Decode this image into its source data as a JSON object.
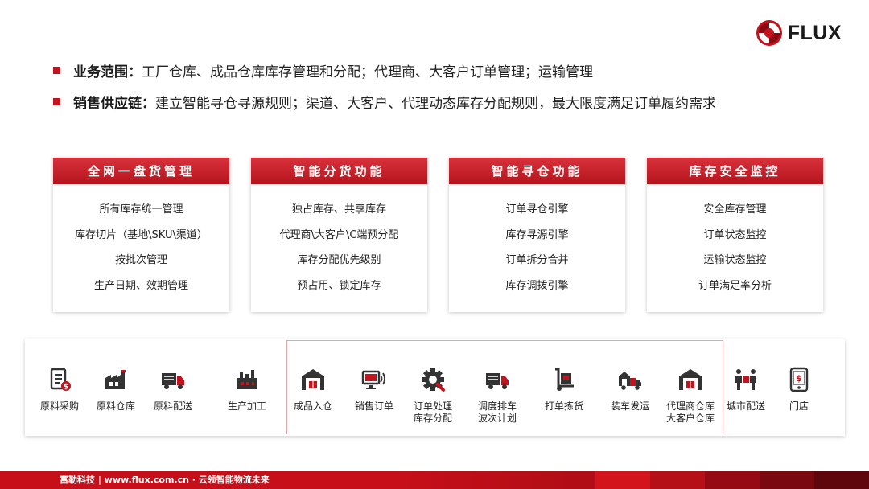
{
  "logo": {
    "text": "FLUX"
  },
  "bullets": [
    {
      "label": "业务范围：",
      "text": "工厂仓库、成品仓库库存管理和分配；代理商、大客户订单管理；运输管理"
    },
    {
      "label": "销售供应链：",
      "text": "建立智能寻仓寻源规则；渠道、大客户、代理动态库存分配规则，最大限度满足订单履约需求"
    }
  ],
  "cards": [
    {
      "title": "全网一盘货管理",
      "items": [
        "所有库存统一管理",
        "库存切片（基地\\SKU\\渠道）",
        "按批次管理",
        "生产日期、效期管理"
      ]
    },
    {
      "title": "智能分货功能",
      "items": [
        "独占库存、共享库存",
        "代理商\\大客户\\C端预分配",
        "库存分配优先级别",
        "预占用、锁定库存"
      ]
    },
    {
      "title": "智能寻仓功能",
      "items": [
        "订单寻仓引擎",
        "库存寻源引擎",
        "订单拆分合并",
        "库存调拨引擎"
      ]
    },
    {
      "title": "库存安全监控",
      "items": [
        "安全库存管理",
        "订单状态监控",
        "运输状态监控",
        "订单满足率分析"
      ]
    }
  ],
  "flow_steps": [
    {
      "label": "原料采购",
      "icon": "invoice-icon"
    },
    {
      "label": "原料仓库",
      "icon": "factory-icon"
    },
    {
      "label": "原料配送",
      "icon": "truck-icon"
    },
    {
      "label": "生产加工",
      "icon": "production-icon"
    },
    {
      "label": "成品入仓",
      "icon": "warehouse-icon"
    },
    {
      "label": "销售订单",
      "icon": "computer-icon"
    },
    {
      "label": "订单处理\n库存分配",
      "icon": "gear-icon"
    },
    {
      "label": "调度排车\n波次计划",
      "icon": "truck-icon"
    },
    {
      "label": "打单拣货",
      "icon": "hand-truck-icon"
    },
    {
      "label": "装车发运",
      "icon": "loading-truck-icon"
    },
    {
      "label": "代理商仓库\n大客户仓库",
      "icon": "warehouse-icon"
    },
    {
      "label": "城市配送",
      "icon": "delivery-person-icon"
    },
    {
      "label": "门店",
      "icon": "store-icon"
    }
  ],
  "footer": {
    "text": "富勒科技 | www.flux.com.cn · 云领智能物流未来"
  },
  "colors": {
    "brand_red": "#c1141e",
    "card_head": "#c61b24",
    "icon_red": "#c1141e",
    "icon_dark": "#333333"
  }
}
